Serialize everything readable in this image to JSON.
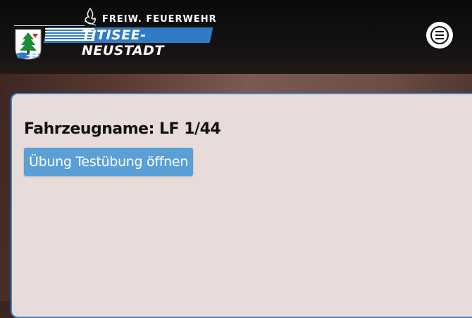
{
  "header": {
    "brand_top": "FREIW. FEUERWEHR",
    "brand_name": "TITISEE-NEUSTADT",
    "menu_icon": "hamburger-menu-icon",
    "brand_color": "#2f7bc8"
  },
  "main": {
    "vehicle_title": "Fahrzeugname: LF 1/44",
    "open_exercise_button": "Übung Testübung öffnen",
    "accent_color": "#5a9fd6",
    "card_border_color": "#3c86c9"
  }
}
